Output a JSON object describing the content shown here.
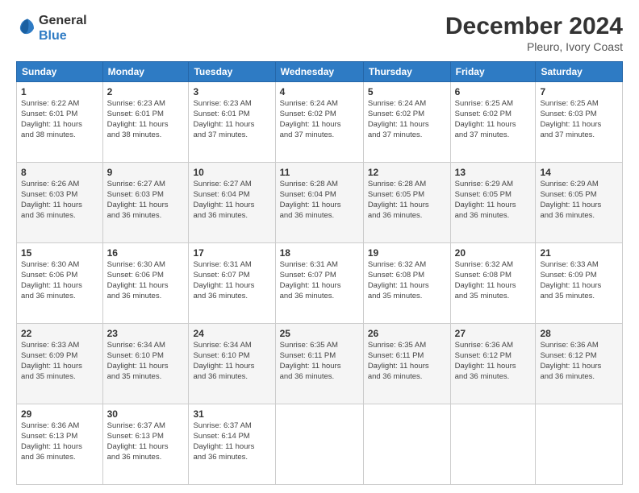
{
  "logo": {
    "line1": "General",
    "line2": "Blue"
  },
  "title": "December 2024",
  "subtitle": "Pleuro, Ivory Coast",
  "days_of_week": [
    "Sunday",
    "Monday",
    "Tuesday",
    "Wednesday",
    "Thursday",
    "Friday",
    "Saturday"
  ],
  "weeks": [
    [
      {
        "num": "1",
        "detail": "Sunrise: 6:22 AM\nSunset: 6:01 PM\nDaylight: 11 hours\nand 38 minutes."
      },
      {
        "num": "2",
        "detail": "Sunrise: 6:23 AM\nSunset: 6:01 PM\nDaylight: 11 hours\nand 38 minutes."
      },
      {
        "num": "3",
        "detail": "Sunrise: 6:23 AM\nSunset: 6:01 PM\nDaylight: 11 hours\nand 37 minutes."
      },
      {
        "num": "4",
        "detail": "Sunrise: 6:24 AM\nSunset: 6:02 PM\nDaylight: 11 hours\nand 37 minutes."
      },
      {
        "num": "5",
        "detail": "Sunrise: 6:24 AM\nSunset: 6:02 PM\nDaylight: 11 hours\nand 37 minutes."
      },
      {
        "num": "6",
        "detail": "Sunrise: 6:25 AM\nSunset: 6:02 PM\nDaylight: 11 hours\nand 37 minutes."
      },
      {
        "num": "7",
        "detail": "Sunrise: 6:25 AM\nSunset: 6:03 PM\nDaylight: 11 hours\nand 37 minutes."
      }
    ],
    [
      {
        "num": "8",
        "detail": "Sunrise: 6:26 AM\nSunset: 6:03 PM\nDaylight: 11 hours\nand 36 minutes."
      },
      {
        "num": "9",
        "detail": "Sunrise: 6:27 AM\nSunset: 6:03 PM\nDaylight: 11 hours\nand 36 minutes."
      },
      {
        "num": "10",
        "detail": "Sunrise: 6:27 AM\nSunset: 6:04 PM\nDaylight: 11 hours\nand 36 minutes."
      },
      {
        "num": "11",
        "detail": "Sunrise: 6:28 AM\nSunset: 6:04 PM\nDaylight: 11 hours\nand 36 minutes."
      },
      {
        "num": "12",
        "detail": "Sunrise: 6:28 AM\nSunset: 6:05 PM\nDaylight: 11 hours\nand 36 minutes."
      },
      {
        "num": "13",
        "detail": "Sunrise: 6:29 AM\nSunset: 6:05 PM\nDaylight: 11 hours\nand 36 minutes."
      },
      {
        "num": "14",
        "detail": "Sunrise: 6:29 AM\nSunset: 6:05 PM\nDaylight: 11 hours\nand 36 minutes."
      }
    ],
    [
      {
        "num": "15",
        "detail": "Sunrise: 6:30 AM\nSunset: 6:06 PM\nDaylight: 11 hours\nand 36 minutes."
      },
      {
        "num": "16",
        "detail": "Sunrise: 6:30 AM\nSunset: 6:06 PM\nDaylight: 11 hours\nand 36 minutes."
      },
      {
        "num": "17",
        "detail": "Sunrise: 6:31 AM\nSunset: 6:07 PM\nDaylight: 11 hours\nand 36 minutes."
      },
      {
        "num": "18",
        "detail": "Sunrise: 6:31 AM\nSunset: 6:07 PM\nDaylight: 11 hours\nand 36 minutes."
      },
      {
        "num": "19",
        "detail": "Sunrise: 6:32 AM\nSunset: 6:08 PM\nDaylight: 11 hours\nand 35 minutes."
      },
      {
        "num": "20",
        "detail": "Sunrise: 6:32 AM\nSunset: 6:08 PM\nDaylight: 11 hours\nand 35 minutes."
      },
      {
        "num": "21",
        "detail": "Sunrise: 6:33 AM\nSunset: 6:09 PM\nDaylight: 11 hours\nand 35 minutes."
      }
    ],
    [
      {
        "num": "22",
        "detail": "Sunrise: 6:33 AM\nSunset: 6:09 PM\nDaylight: 11 hours\nand 35 minutes."
      },
      {
        "num": "23",
        "detail": "Sunrise: 6:34 AM\nSunset: 6:10 PM\nDaylight: 11 hours\nand 35 minutes."
      },
      {
        "num": "24",
        "detail": "Sunrise: 6:34 AM\nSunset: 6:10 PM\nDaylight: 11 hours\nand 36 minutes."
      },
      {
        "num": "25",
        "detail": "Sunrise: 6:35 AM\nSunset: 6:11 PM\nDaylight: 11 hours\nand 36 minutes."
      },
      {
        "num": "26",
        "detail": "Sunrise: 6:35 AM\nSunset: 6:11 PM\nDaylight: 11 hours\nand 36 minutes."
      },
      {
        "num": "27",
        "detail": "Sunrise: 6:36 AM\nSunset: 6:12 PM\nDaylight: 11 hours\nand 36 minutes."
      },
      {
        "num": "28",
        "detail": "Sunrise: 6:36 AM\nSunset: 6:12 PM\nDaylight: 11 hours\nand 36 minutes."
      }
    ],
    [
      {
        "num": "29",
        "detail": "Sunrise: 6:36 AM\nSunset: 6:13 PM\nDaylight: 11 hours\nand 36 minutes."
      },
      {
        "num": "30",
        "detail": "Sunrise: 6:37 AM\nSunset: 6:13 PM\nDaylight: 11 hours\nand 36 minutes."
      },
      {
        "num": "31",
        "detail": "Sunrise: 6:37 AM\nSunset: 6:14 PM\nDaylight: 11 hours\nand 36 minutes."
      },
      null,
      null,
      null,
      null
    ]
  ]
}
